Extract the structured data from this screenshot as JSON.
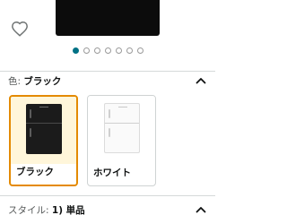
{
  "product": {
    "image_alt": "refrigerator-product-image",
    "gallery": {
      "total": 7,
      "active_index": 0
    }
  },
  "icons": {
    "favorite": "heart-outline-icon",
    "collapse": "chevron-up-icon"
  },
  "color_section": {
    "label": "色:",
    "selected": "ブラック",
    "options": [
      {
        "name": "ブラック",
        "selected": true
      },
      {
        "name": "ホワイト",
        "selected": false
      }
    ]
  },
  "style_section": {
    "label": "スタイル:",
    "selected": "1) 単品"
  },
  "colors": {
    "accent": "#007185",
    "selected_border": "#e48a00",
    "selected_swatch_bg": "#fff6da",
    "divider": "#d5d9d9"
  }
}
